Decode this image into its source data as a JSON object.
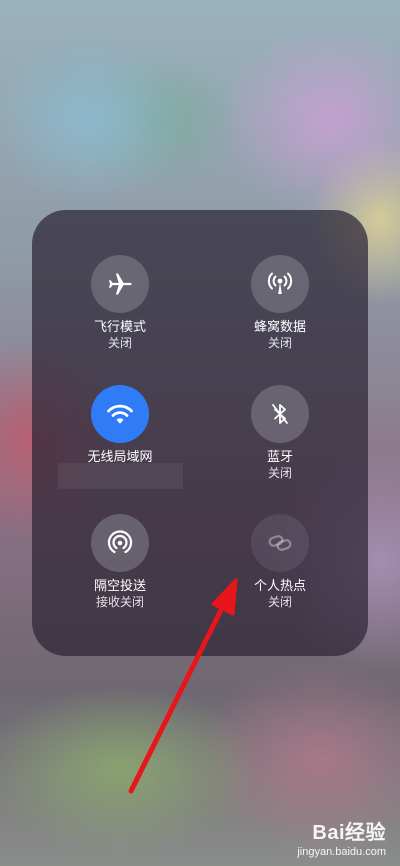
{
  "panel": {
    "tiles": [
      {
        "icon": "airplane-icon",
        "label": "飞行模式",
        "status": "关闭",
        "active": false
      },
      {
        "icon": "cellular-antenna-icon",
        "label": "蜂窝数据",
        "status": "关闭",
        "active": false
      },
      {
        "icon": "wifi-icon",
        "label": "无线局域网",
        "status": "",
        "active": true,
        "accent": "#2f7cf6"
      },
      {
        "icon": "bluetooth-icon",
        "label": "蓝牙",
        "status": "关闭",
        "active": false
      },
      {
        "icon": "airdrop-icon",
        "label": "隔空投送",
        "status": "接收关闭",
        "active": false
      },
      {
        "icon": "personal-hotspot-icon",
        "label": "个人热点",
        "status": "关闭",
        "active": false
      }
    ]
  },
  "annotation": {
    "arrow_color": "#e8151b"
  },
  "watermark": {
    "logo_text": "Bai经验",
    "url": "jingyan.baidu.com"
  }
}
